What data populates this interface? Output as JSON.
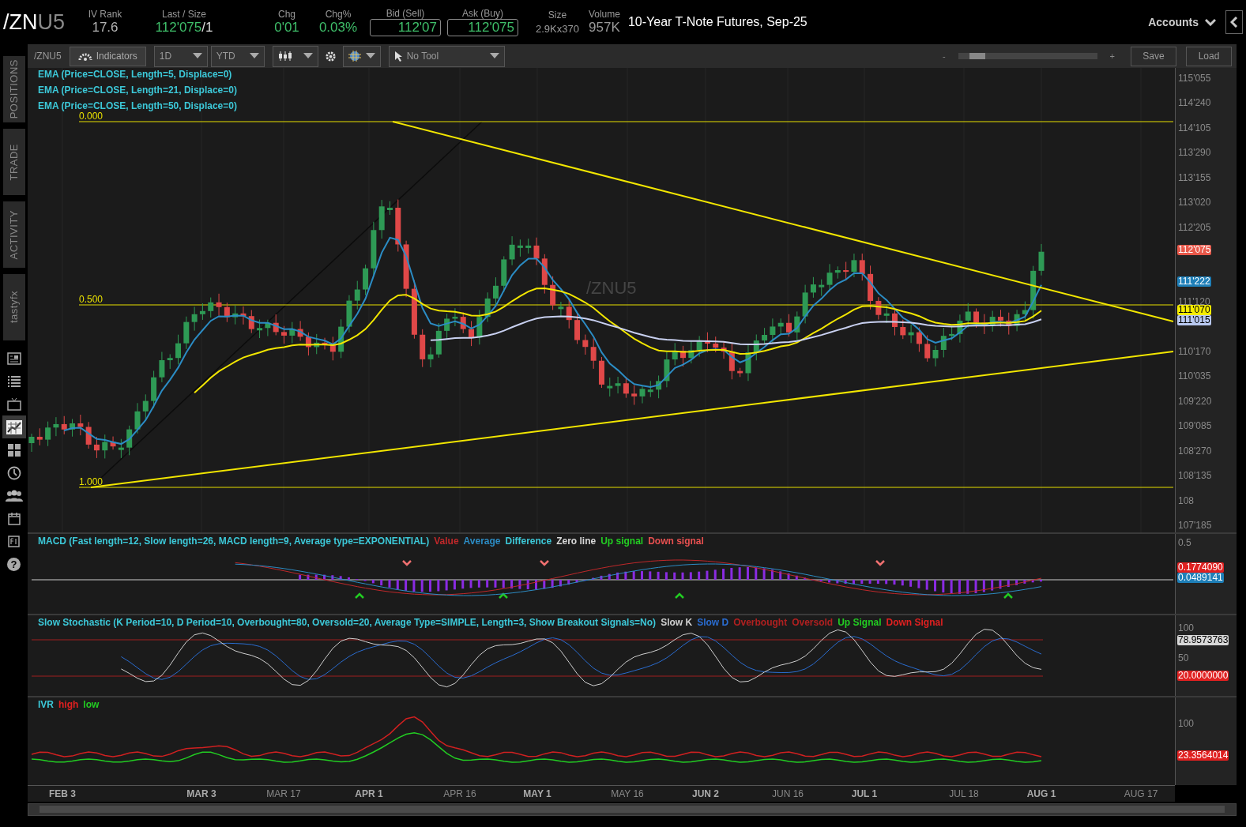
{
  "header": {
    "symbol": {
      "root": "/ZN",
      "suffix": "U5"
    },
    "quotes": [
      {
        "label": "IV Rank",
        "value": "17.6",
        "kind": "plain",
        "color": "#b4b4b4"
      },
      {
        "label": "Last / Size",
        "value": "112'075",
        "extra": "/1",
        "kind": "plain",
        "color": "#3fbf6a"
      },
      {
        "label": "Chg",
        "value": "0'01",
        "kind": "plain",
        "color": "#3fbf6a"
      },
      {
        "label": "Chg%",
        "value": "0.03%",
        "kind": "plain",
        "color": "#3fbf6a"
      },
      {
        "label": "Bid (Sell)",
        "value": "112'07",
        "kind": "box",
        "color": "#3fbf6a"
      },
      {
        "label": "Ask (Buy)",
        "value": "112'075",
        "kind": "box",
        "color": "#3fbf6a"
      },
      {
        "label": "Size",
        "value": "2.9Kx370",
        "kind": "small",
        "color": "#9a9a9a"
      },
      {
        "label": "Volume",
        "value": "957K",
        "kind": "plain",
        "color": "#9a9a9a"
      }
    ],
    "title": "10-Year T-Note Futures, Sep-25",
    "accounts": "Accounts"
  },
  "sidebar": {
    "tabs": [
      {
        "label": "POSITIONS"
      },
      {
        "label": "TRADE"
      },
      {
        "label": "ACTIVITY"
      },
      {
        "label": "tastyfx"
      }
    ],
    "icons": [
      {
        "kind": "news",
        "selected": false
      },
      {
        "kind": "list",
        "selected": false
      },
      {
        "kind": "tv",
        "selected": false
      },
      {
        "kind": "chart",
        "selected": true
      },
      {
        "kind": "grid",
        "selected": false
      },
      {
        "kind": "clock",
        "selected": false
      },
      {
        "kind": "people",
        "selected": false
      },
      {
        "kind": "calendar",
        "selected": false
      },
      {
        "kind": "doc",
        "selected": false
      },
      {
        "kind": "help",
        "selected": false,
        "glyph": "?"
      }
    ]
  },
  "toolbar": {
    "symbol": "/ZNU5",
    "indicators": "Indicators",
    "interval": "1D",
    "range": "YTD",
    "tool": "No Tool",
    "zoom_out": "-",
    "zoom_in": "+",
    "zoom": {
      "level": 0.08
    },
    "buttons": [
      "Save",
      "Load"
    ]
  },
  "main_chart": {
    "studies": [
      "EMA (Price=CLOSE, Length=5, Displace=0)",
      "EMA (Price=CLOSE, Length=21, Displace=0)",
      "EMA (Price=CLOSE, Length=50, Displace=0)"
    ],
    "watermark": "/ZNU5",
    "fib_levels": [
      "0.000",
      "0.500",
      "1.000"
    ],
    "price_ticks": [
      "115'055",
      "114'240",
      "114'105",
      "113'290",
      "113'155",
      "113'020",
      "112'205",
      "111'120",
      "110'170",
      "110'035",
      "109'220",
      "109'085",
      "108'270",
      "108'135",
      "108",
      "107'185"
    ],
    "price_badges": [
      {
        "text": "112'075",
        "color": "#e8584a"
      },
      {
        "text": "111'222",
        "color": "#1e7fb8"
      },
      {
        "text": "111'070",
        "color": "#f5ec00"
      },
      {
        "text": "111'015",
        "color": "#b8c8f0"
      }
    ]
  },
  "macd": {
    "legend": [
      {
        "text": "MACD (Fast length=12, Slow length=26, MACD length=9, Average type=EXPONENTIAL)",
        "color": "#3cc8d8"
      },
      {
        "text": "Value",
        "color": "#c0282a"
      },
      {
        "text": "Average",
        "color": "#2c8cc4"
      },
      {
        "text": "Difference",
        "color": "#3cc8d8"
      },
      {
        "text": "Zero line",
        "color": "#d8d8d8"
      },
      {
        "text": "Up signal",
        "color": "#22cc22"
      },
      {
        "text": "Down signal",
        "color": "#e85050"
      }
    ],
    "ticks": [
      "0.5"
    ],
    "badges": [
      {
        "text": "0.1774090",
        "color": "#e02020"
      },
      {
        "text": "0.0489141",
        "color": "#1e7fb8"
      }
    ]
  },
  "stochastic": {
    "legend": [
      {
        "text": "Slow Stochastic (K Period=10, D Period=10, Overbought=80, Oversold=20, Average Type=SIMPLE, Length=3, Show Breakout Signals=No)",
        "color": "#3cc8d8"
      },
      {
        "text": "Slow K",
        "color": "#d0d0d0"
      },
      {
        "text": "Slow D",
        "color": "#2a6cd0"
      },
      {
        "text": "Overbought",
        "color": "#b02020"
      },
      {
        "text": "Oversold",
        "color": "#b02020"
      },
      {
        "text": "Up Signal",
        "color": "#22cc22"
      },
      {
        "text": "Down Signal",
        "color": "#e02020"
      }
    ],
    "ticks": [
      "100",
      "50"
    ],
    "badges": [
      {
        "text": "78.9573763",
        "color": "#d8d8d8"
      },
      {
        "text": "20.0000000",
        "color": "#e02020"
      }
    ]
  },
  "ivr": {
    "legend": [
      {
        "text": "IVR",
        "color": "#3cc8d8"
      },
      {
        "text": "high",
        "color": "#e02020"
      },
      {
        "text": "low",
        "color": "#22cc22"
      }
    ],
    "ticks": [
      "100"
    ],
    "badges": [
      {
        "text": "23.3564014",
        "color": "#e02020"
      }
    ]
  },
  "dates": [
    {
      "label": "FEB 3",
      "major": true
    },
    {
      "label": "MAR 3",
      "major": true
    },
    {
      "label": "MAR 17",
      "major": false
    },
    {
      "label": "APR 1",
      "major": true
    },
    {
      "label": "APR 16",
      "major": false
    },
    {
      "label": "MAY 1",
      "major": true
    },
    {
      "label": "MAY 16",
      "major": false
    },
    {
      "label": "JUN 2",
      "major": true
    },
    {
      "label": "JUN 16",
      "major": false
    },
    {
      "label": "JUL 1",
      "major": true
    },
    {
      "label": "JUL 18",
      "major": false
    },
    {
      "label": "AUG 1",
      "major": true
    },
    {
      "label": "AUG 17",
      "major": false
    }
  ]
}
